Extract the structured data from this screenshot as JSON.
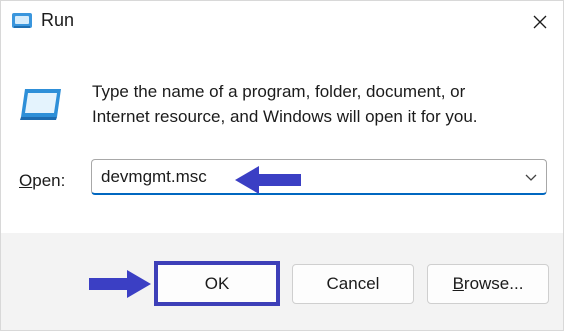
{
  "window": {
    "title": "Run",
    "close_icon": "close-icon",
    "title_icon": "run-app-icon"
  },
  "content": {
    "description_line1": "Type the name of a program, folder, document, or",
    "description_line2": "Internet resource, and Windows will open it for you.",
    "open_label_prefix": "O",
    "open_label_rest": "pen:",
    "open_value": "devmgmt.msc"
  },
  "buttons": {
    "ok": "OK",
    "cancel": "Cancel",
    "browse_prefix": "B",
    "browse_rest": "rowse..."
  },
  "annotations": {
    "arrow_color": "#3b3fc4",
    "ok_highlight_color": "#3d3fb8"
  }
}
